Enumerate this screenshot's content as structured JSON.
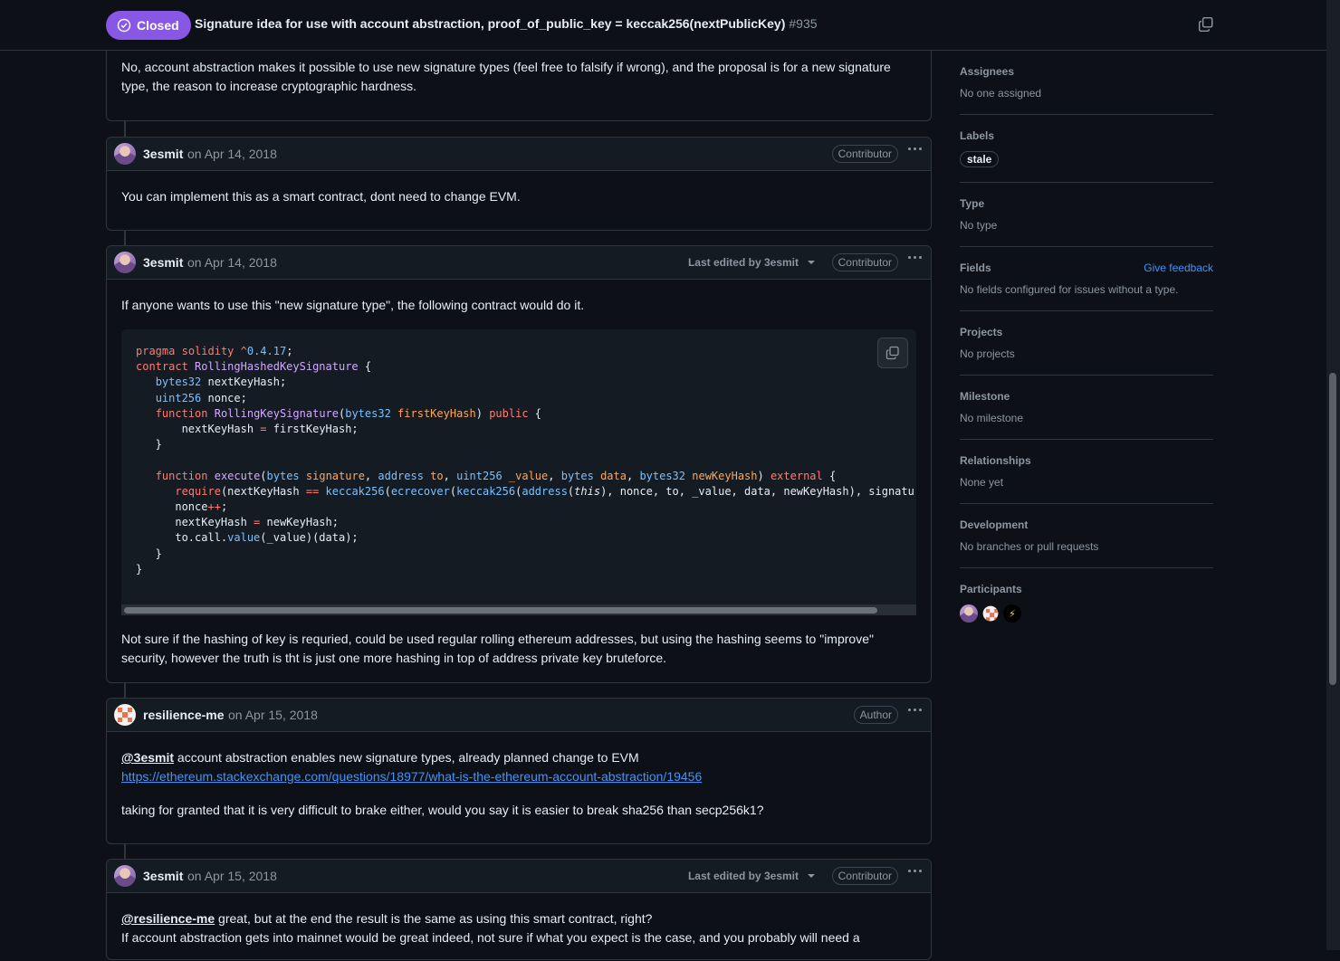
{
  "header": {
    "state": "Closed",
    "title": "Signature idea for use with account abstraction, proof_of_public_key = keccak256(nextPublicKey)",
    "number": "#935"
  },
  "comments": [
    {
      "body": "No, account abstraction makes it possible to use new signature types (feel free to falsify if wrong), and the proposal is for a new signature type, the reason to increase cryptographic hardness."
    },
    {
      "author": "3esmit",
      "date": "on Apr 14, 2018",
      "role": "Contributor",
      "body": "You can implement this as a smart contract, dont need to change EVM."
    },
    {
      "author": "3esmit",
      "date": "on Apr 14, 2018",
      "edited": "Last edited by 3esmit",
      "role": "Contributor",
      "intro": "If anyone wants to use this \"new signature type\", the following contract would do it.",
      "outro": "Not sure if the hashing of key is requried, could be used regular rolling ethereum addresses, but using the hashing seems to \"improve\" security, however the truth is tht is just one more hashing in top of address private key bruteforce."
    },
    {
      "author": "resilience-me",
      "date": "on Apr 15, 2018",
      "role": "Author",
      "mention": "@3esmit",
      "line1": " account abstraction enables new signature types, already planned change to EVM",
      "link": "https://ethereum.stackexchange.com/questions/18977/what-is-the-ethereum-account-abstraction/19456",
      "para2": "taking for granted that it is very difficult to brake either, would you say it is easier to break sha256 than secp256k1?"
    },
    {
      "author": "3esmit",
      "date": "on Apr 15, 2018",
      "edited": "Last edited by 3esmit",
      "role": "Contributor",
      "mention": "@resilience-me",
      "line1": " great, but at the end the result is the same as using this smart contract, right?",
      "line2": "If account abstraction gets into mainnet would be great indeed, not sure if what you expect is the case, and you probably will need a"
    }
  ],
  "code": {
    "language": "solidity",
    "lines": [
      [
        [
          "kw",
          "pragma"
        ],
        [
          "",
          " "
        ],
        [
          "kw",
          "solidity"
        ],
        [
          "",
          " "
        ],
        [
          "kw",
          "^"
        ],
        [
          "num",
          "0.4.17"
        ],
        [
          "",
          ";"
        ]
      ],
      [
        [
          "kw",
          "contract"
        ],
        [
          "",
          " "
        ],
        [
          "fn",
          "RollingHashedKeySignature"
        ],
        [
          "",
          " {"
        ]
      ],
      [
        [
          "",
          "   "
        ],
        [
          "ty",
          "bytes32"
        ],
        [
          "",
          " nextKeyHash;"
        ]
      ],
      [
        [
          "",
          "   "
        ],
        [
          "ty",
          "uint256"
        ],
        [
          "",
          " nonce;"
        ]
      ],
      [
        [
          "",
          "   "
        ],
        [
          "kw",
          "function"
        ],
        [
          "",
          " "
        ],
        [
          "fn",
          "RollingKeySignature"
        ],
        [
          "",
          "("
        ],
        [
          "ty",
          "bytes32"
        ],
        [
          "",
          " "
        ],
        [
          "va",
          "firstKeyHash"
        ],
        [
          "",
          ") "
        ],
        [
          "kw",
          "public"
        ],
        [
          "",
          " {"
        ]
      ],
      [
        [
          "",
          "       nextKeyHash "
        ],
        [
          "kw",
          "="
        ],
        [
          "",
          " firstKeyHash;"
        ]
      ],
      [
        [
          "",
          "   }"
        ]
      ],
      [
        [
          "",
          ""
        ]
      ],
      [
        [
          "",
          "   "
        ],
        [
          "kw",
          "function"
        ],
        [
          "",
          " "
        ],
        [
          "fn",
          "execute"
        ],
        [
          "",
          "("
        ],
        [
          "ty",
          "bytes"
        ],
        [
          "",
          " "
        ],
        [
          "va",
          "signature"
        ],
        [
          "",
          ", "
        ],
        [
          "ty",
          "address"
        ],
        [
          "",
          " "
        ],
        [
          "va",
          "to"
        ],
        [
          "",
          ", "
        ],
        [
          "ty",
          "uint256"
        ],
        [
          "",
          " "
        ],
        [
          "va",
          "_value"
        ],
        [
          "",
          ", "
        ],
        [
          "ty",
          "bytes"
        ],
        [
          "",
          " "
        ],
        [
          "va",
          "data"
        ],
        [
          "",
          ", "
        ],
        [
          "ty",
          "bytes32"
        ],
        [
          "",
          " "
        ],
        [
          "va",
          "newKeyHash"
        ],
        [
          "",
          ") "
        ],
        [
          "kw",
          "external"
        ],
        [
          "",
          " {"
        ]
      ],
      [
        [
          "",
          "      "
        ],
        [
          "kw",
          "require"
        ],
        [
          "",
          "(nextKeyHash "
        ],
        [
          "kw",
          "=="
        ],
        [
          "",
          " "
        ],
        [
          "ty",
          "keccak256"
        ],
        [
          "",
          "("
        ],
        [
          "ty",
          "ecrecover"
        ],
        [
          "",
          "("
        ],
        [
          "ty",
          "keccak256"
        ],
        [
          "",
          "("
        ],
        [
          "ty",
          "address"
        ],
        [
          "",
          "("
        ],
        [
          "it",
          "this"
        ],
        [
          "",
          "), nonce, to, _value, data, newKeyHash), signature"
        ]
      ],
      [
        [
          "",
          "      nonce"
        ],
        [
          "kw",
          "++"
        ],
        [
          "",
          ";"
        ]
      ],
      [
        [
          "",
          "      nextKeyHash "
        ],
        [
          "kw",
          "="
        ],
        [
          "",
          " newKeyHash;"
        ]
      ],
      [
        [
          "",
          "      to.call."
        ],
        [
          "ty",
          "value"
        ],
        [
          "",
          "(_value)(data);"
        ]
      ],
      [
        [
          "",
          "   }"
        ]
      ],
      [
        [
          "",
          "}"
        ]
      ]
    ]
  },
  "sidebar": {
    "assignees": {
      "title": "Assignees",
      "value": "No one assigned"
    },
    "labels": {
      "title": "Labels",
      "items": [
        "stale"
      ]
    },
    "type": {
      "title": "Type",
      "value": "No type"
    },
    "fields": {
      "title": "Fields",
      "action": "Give feedback",
      "value": "No fields configured for issues without a type."
    },
    "projects": {
      "title": "Projects",
      "value": "No projects"
    },
    "milestone": {
      "title": "Milestone",
      "value": "No milestone"
    },
    "relationships": {
      "title": "Relationships",
      "value": "None yet"
    },
    "development": {
      "title": "Development",
      "value": "No branches or pull requests"
    },
    "participants": {
      "title": "Participants",
      "bolt": "⚡"
    }
  },
  "colors": {
    "closed": "#8957e5",
    "link": "#4493f8",
    "bg": "#0d1117"
  }
}
